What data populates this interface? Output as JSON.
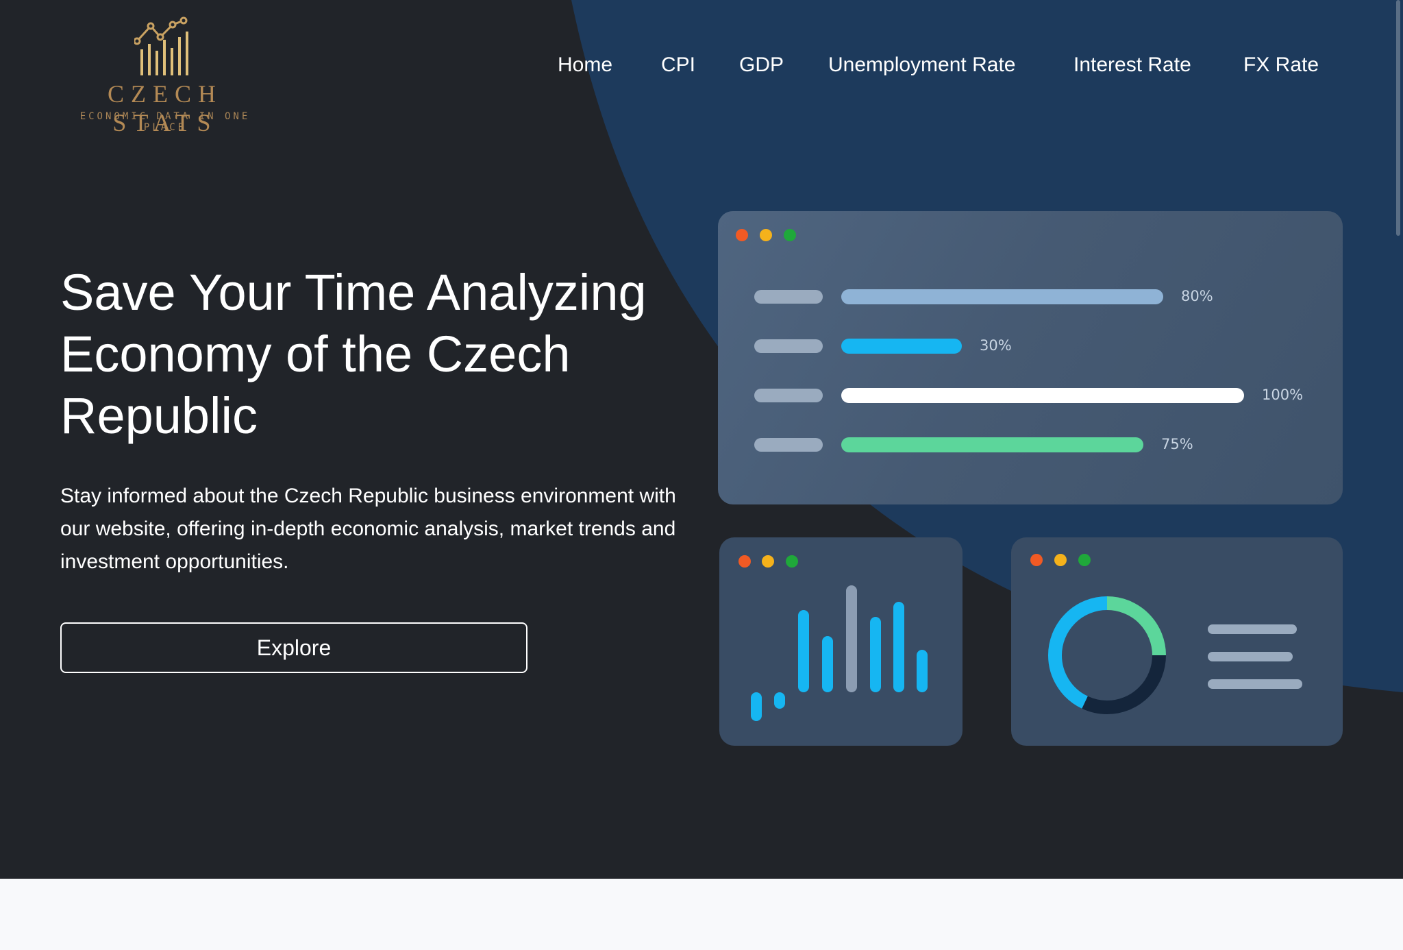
{
  "logo": {
    "title": "CZECH STATS",
    "subtitle": "ECONOMIC DATA IN ONE PLACE",
    "icon": "rising-bar-chart-icon"
  },
  "nav": {
    "items": [
      {
        "label": "Home"
      },
      {
        "label": "CPI"
      },
      {
        "label": "GDP"
      },
      {
        "label": "Unemployment Rate"
      },
      {
        "label": "Interest Rate"
      },
      {
        "label": "FX Rate"
      }
    ]
  },
  "hero": {
    "headline": "Save Your Time Analyzing Economy of the Czech Republic",
    "lead": "Stay informed about the Czech Republic business environment with our website, offering in-depth economic analysis, market trends and investment opportunities.",
    "cta_label": "Explore"
  },
  "illustration": {
    "progress_bars": [
      {
        "percent_label": "80%",
        "value": 0.8,
        "color": "#8fb3d6"
      },
      {
        "percent_label": "30%",
        "value": 0.3,
        "color": "#16b6f2"
      },
      {
        "percent_label": "100%",
        "value": 1.0,
        "color": "#ffffff"
      },
      {
        "percent_label": "75%",
        "value": 0.75,
        "color": "#5cd69b"
      }
    ],
    "window_dots": [
      "#f15a24",
      "#f5b21b",
      "#1fa83a"
    ],
    "donut": {
      "segments": [
        {
          "value": 0.25,
          "color": "#5cd69b"
        },
        {
          "value": 0.32,
          "color": "#14253b"
        },
        {
          "value": 0.43,
          "color": "#16b6f2"
        }
      ]
    },
    "colors": {
      "page_bg": "#212429",
      "curve": "#1d3a5c",
      "accent_gold": "#b48a55"
    }
  }
}
